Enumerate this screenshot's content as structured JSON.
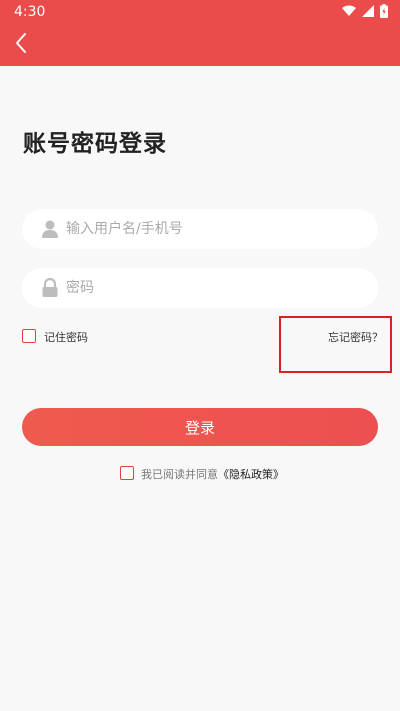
{
  "status_bar": {
    "time": "4:30"
  },
  "colors": {
    "accent": "#ea4b4b",
    "background": "#f8f8f8",
    "highlight": "#e02020"
  },
  "header": {
    "back_icon": "chevron-left-icon"
  },
  "page": {
    "title": "账号密码登录"
  },
  "form": {
    "username": {
      "placeholder": "输入用户名/手机号",
      "value": "",
      "icon": "user-icon"
    },
    "password": {
      "placeholder": "密码",
      "value": "",
      "icon": "lock-icon"
    },
    "remember_label": "记住密码",
    "forgot_label": "忘记密码？",
    "login_label": "登录",
    "agreement": {
      "prefix": "我已阅读并同意",
      "link": "《隐私政策》"
    }
  }
}
